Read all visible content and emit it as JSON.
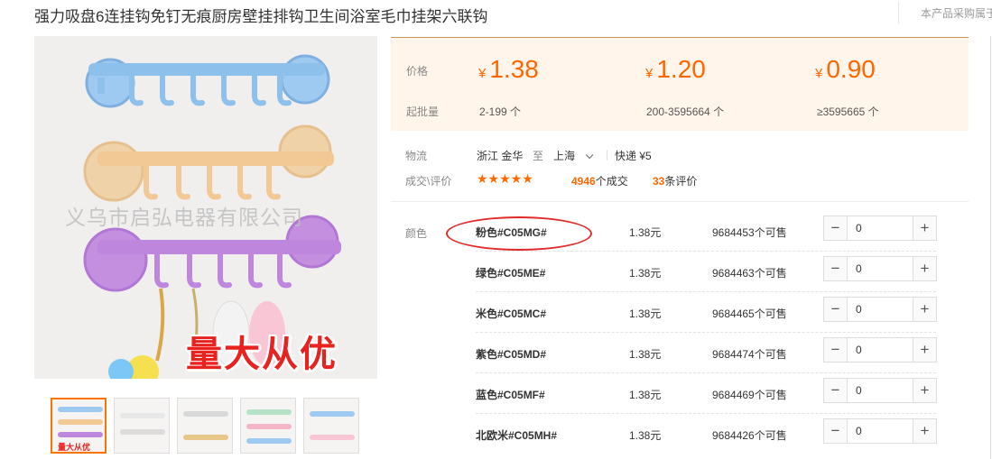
{
  "product": {
    "title": "强力吸盘6连挂钩免钉无痕厨房壁挂排钩卫生间浴室毛巾挂架六联钩",
    "right_note": "本产品采购属于",
    "watermark": "义乌市启弘电器有限公司",
    "promo": "量大从优"
  },
  "thumbnails": [
    {
      "name": "thumb-1",
      "active": true,
      "caption": "量大从优"
    },
    {
      "name": "thumb-2",
      "active": false
    },
    {
      "name": "thumb-3",
      "active": false
    },
    {
      "name": "thumb-4",
      "active": false
    },
    {
      "name": "thumb-5",
      "active": false
    }
  ],
  "pricing": {
    "price_label": "价格",
    "moq_label": "起批量",
    "currency": "¥",
    "tiers": [
      {
        "price": "1.38",
        "range": "2-199 个"
      },
      {
        "price": "1.20",
        "range": "200-3595664 个"
      },
      {
        "price": "0.90",
        "range": "≥3595665 个"
      }
    ]
  },
  "logistics": {
    "label": "物流",
    "from": "浙江 金华",
    "to_word": "至",
    "to": "上海",
    "method": "快递 ¥5"
  },
  "reviews": {
    "label": "成交\\评价",
    "stars": "★★★★★",
    "deals_count": "4946",
    "deals_suffix": "个成交",
    "review_count": "33",
    "review_suffix": "条评价"
  },
  "variants": {
    "label": "颜色",
    "rows": [
      {
        "name": "粉色#C05MG#",
        "price": "1.38元",
        "stock": "9684453个可售",
        "qty": "0"
      },
      {
        "name": "绿色#C05ME#",
        "price": "1.38元",
        "stock": "9684463个可售",
        "qty": "0"
      },
      {
        "name": "米色#C05MC#",
        "price": "1.38元",
        "stock": "9684465个可售",
        "qty": "0"
      },
      {
        "name": "紫色#C05MD#",
        "price": "1.38元",
        "stock": "9684474个可售",
        "qty": "0"
      },
      {
        "name": "蓝色#C05MF#",
        "price": "1.38元",
        "stock": "9684469个可售",
        "qty": "0"
      },
      {
        "name": "北欧米#C05MH#",
        "price": "1.38元",
        "stock": "9684426个可售",
        "qty": "0"
      }
    ]
  },
  "stepper": {
    "minus": "−",
    "plus": "+"
  },
  "colors": {
    "accent": "#ff6600",
    "annotation": "#e12b2b",
    "price_bg": "#fff5ea"
  }
}
